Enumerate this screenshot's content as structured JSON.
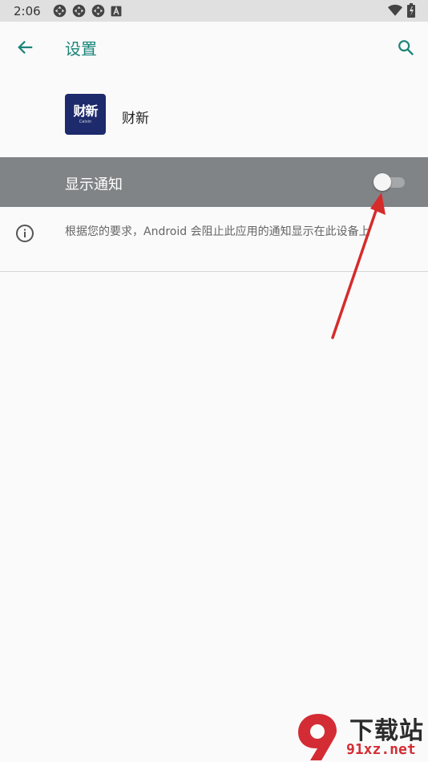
{
  "status_bar": {
    "time": "2:06",
    "left_icons": [
      "sync-icon",
      "sync-icon",
      "sync-icon",
      "a-icon"
    ],
    "right_icons": [
      "wifi-icon",
      "battery-icon"
    ]
  },
  "app_bar": {
    "title": "设置",
    "back_icon": "arrow-back-icon",
    "search_icon": "search-icon"
  },
  "app_info": {
    "icon_text": "财新",
    "icon_subtext": "Caixin",
    "name": "财新"
  },
  "notification_toggle": {
    "label": "显示通知",
    "state": "off"
  },
  "info": {
    "text": "根据您的要求，Android 会阻止此应用的通知显示在此设备上"
  },
  "watermark": {
    "title": "下载站",
    "url": "91xz.net"
  },
  "colors": {
    "accent": "#1a8479",
    "toggle_row_bg": "#818487",
    "annotation_arrow": "#d62b2b",
    "app_icon_bg": "#1d2a6b"
  }
}
